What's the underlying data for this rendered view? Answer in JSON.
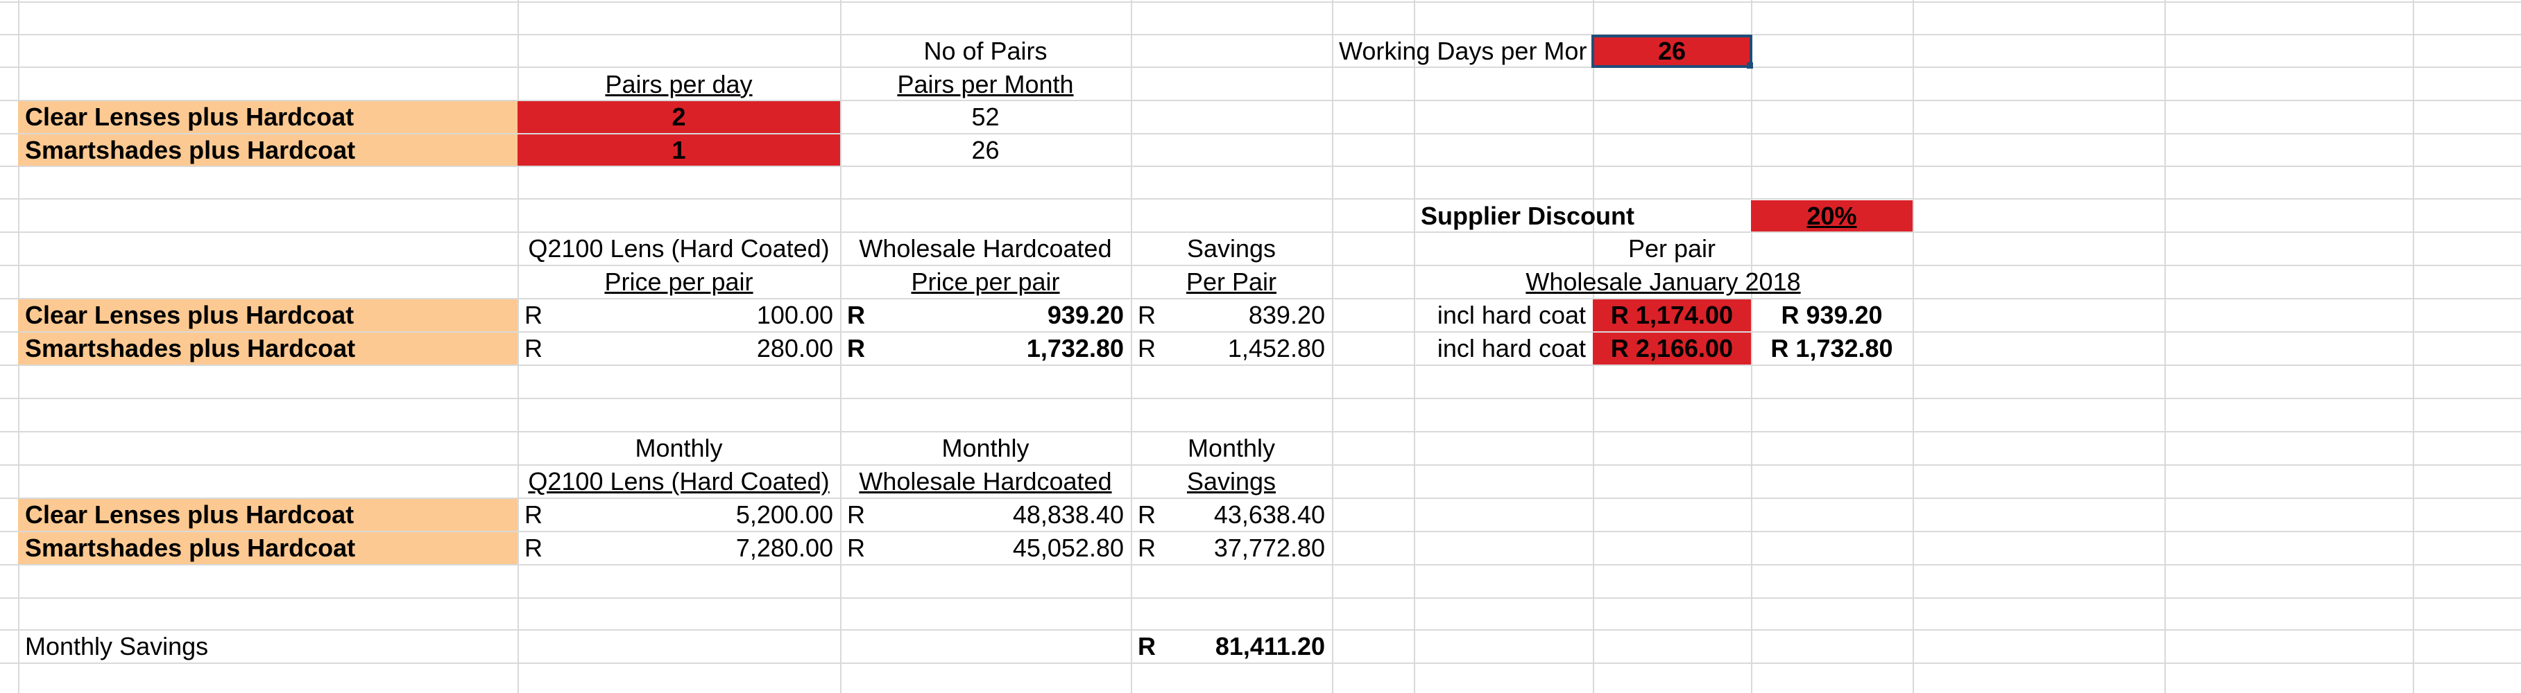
{
  "labels": {
    "clear": "Clear Lenses plus Hardcoat",
    "smart": "Smartshades plus Hardcoat"
  },
  "top": {
    "no_of_pairs": "No of Pairs",
    "pairs_per_day": "Pairs per day",
    "pairs_per_month": "Pairs per Month",
    "clear_day": "2",
    "smart_day": "1",
    "clear_month": "52",
    "smart_month": "26",
    "working_days_label": "Working Days per Mor",
    "working_days_value": "26"
  },
  "supplier": {
    "discount_label": "Supplier Discount",
    "discount_value": "20%",
    "per_pair": "Per pair",
    "wholesale_jan": "Wholesale January 2018",
    "incl1": "incl hard coat",
    "incl2": "incl hard coat",
    "price1": "R 1,174.00",
    "price2": "R 2,166.00",
    "disc1": "R 939.20",
    "disc2": "R 1,732.80"
  },
  "per_pair": {
    "h1_q2100": "Q2100 Lens (Hard Coated)",
    "h1_wholesale": "Wholesale Hardcoated",
    "h1_savings": "Savings",
    "h2_price1": "Price per pair",
    "h2_price2": "Price per pair",
    "h2_perpair": "Per Pair",
    "currency": "R",
    "clear_q2100": "100.00",
    "clear_wholesale": "939.20",
    "clear_savings": "839.20",
    "smart_q2100": "280.00",
    "smart_wholesale": "1,732.80",
    "smart_savings": "1,452.80"
  },
  "monthly": {
    "h1_a": "Monthly",
    "h1_b": "Monthly",
    "h1_c": "Monthly",
    "h2_q2100": "Q2100 Lens (Hard Coated)",
    "h2_wholesale": "Wholesale Hardcoated",
    "h2_savings": "Savings",
    "currency": "R",
    "clear_q2100": "5,200.00",
    "clear_wholesale": "48,838.40",
    "clear_savings": "43,638.40",
    "smart_q2100": "7,280.00",
    "smart_wholesale": "45,052.80",
    "smart_savings": "37,772.80"
  },
  "total": {
    "label": "Monthly Savings",
    "currency": "R",
    "value": "81,411.20"
  },
  "colors": {
    "peach": "#fcc992",
    "red": "#da2128",
    "gridline": "#d9d9d9",
    "selection": "#1f4e79"
  }
}
